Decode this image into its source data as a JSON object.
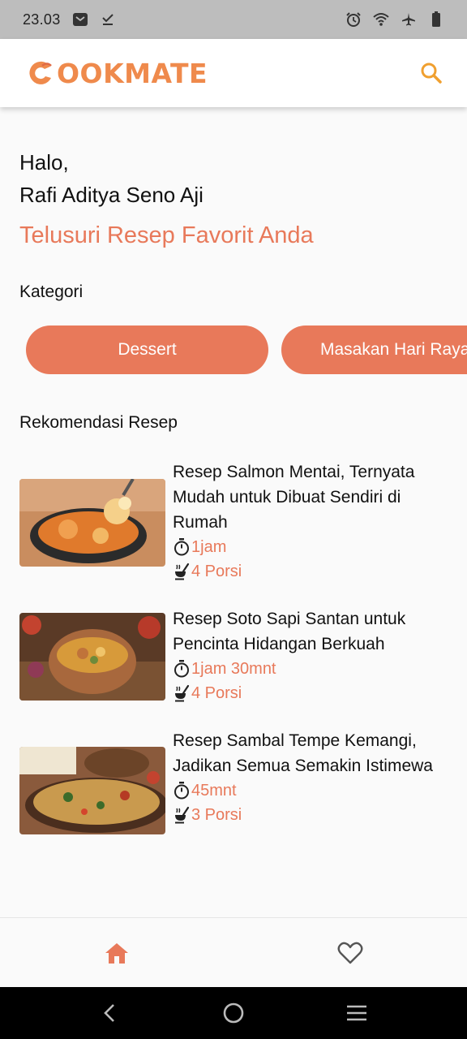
{
  "status_bar": {
    "time": "23.03",
    "left_icons": [
      "mail-icon",
      "download-done-icon"
    ],
    "right_icons": [
      "alarm-icon",
      "wifi-icon",
      "airplane-icon",
      "battery-icon"
    ]
  },
  "app_bar": {
    "logo_text": "COOKMATE",
    "logo_rest": "OOKMATE",
    "brand_color": "#ef8a4c",
    "search_icon": "search-icon"
  },
  "greeting": {
    "line1": "Halo,",
    "name": "Rafi Aditya Seno Aji"
  },
  "tagline": "Telusuri Resep Favorit Anda",
  "categories": {
    "label": "Kategori",
    "items": [
      "Dessert",
      "Masakan Hari Raya"
    ]
  },
  "recommendations": {
    "label": "Rekomendasi Resep",
    "items": [
      {
        "title": "Resep Salmon Mentai, Ternyata Mudah untuk Dibuat Sendiri di Rumah",
        "time": "1jam",
        "portion": "4 Porsi"
      },
      {
        "title": "Resep Soto Sapi Santan untuk Pencinta Hidangan Berkuah",
        "time": "1jam 30mnt",
        "portion": "4 Porsi"
      },
      {
        "title": "Resep Sambal Tempe Kemangi, Jadikan Semua Semakin Istimewa",
        "time": "45mnt",
        "portion": "3 Porsi"
      }
    ]
  },
  "bottom_nav": {
    "items": [
      {
        "icon": "home-icon",
        "active": true
      },
      {
        "icon": "heart-icon",
        "active": false
      }
    ]
  },
  "colors": {
    "accent": "#e8795a",
    "status_bar": "#bdbdbd"
  }
}
